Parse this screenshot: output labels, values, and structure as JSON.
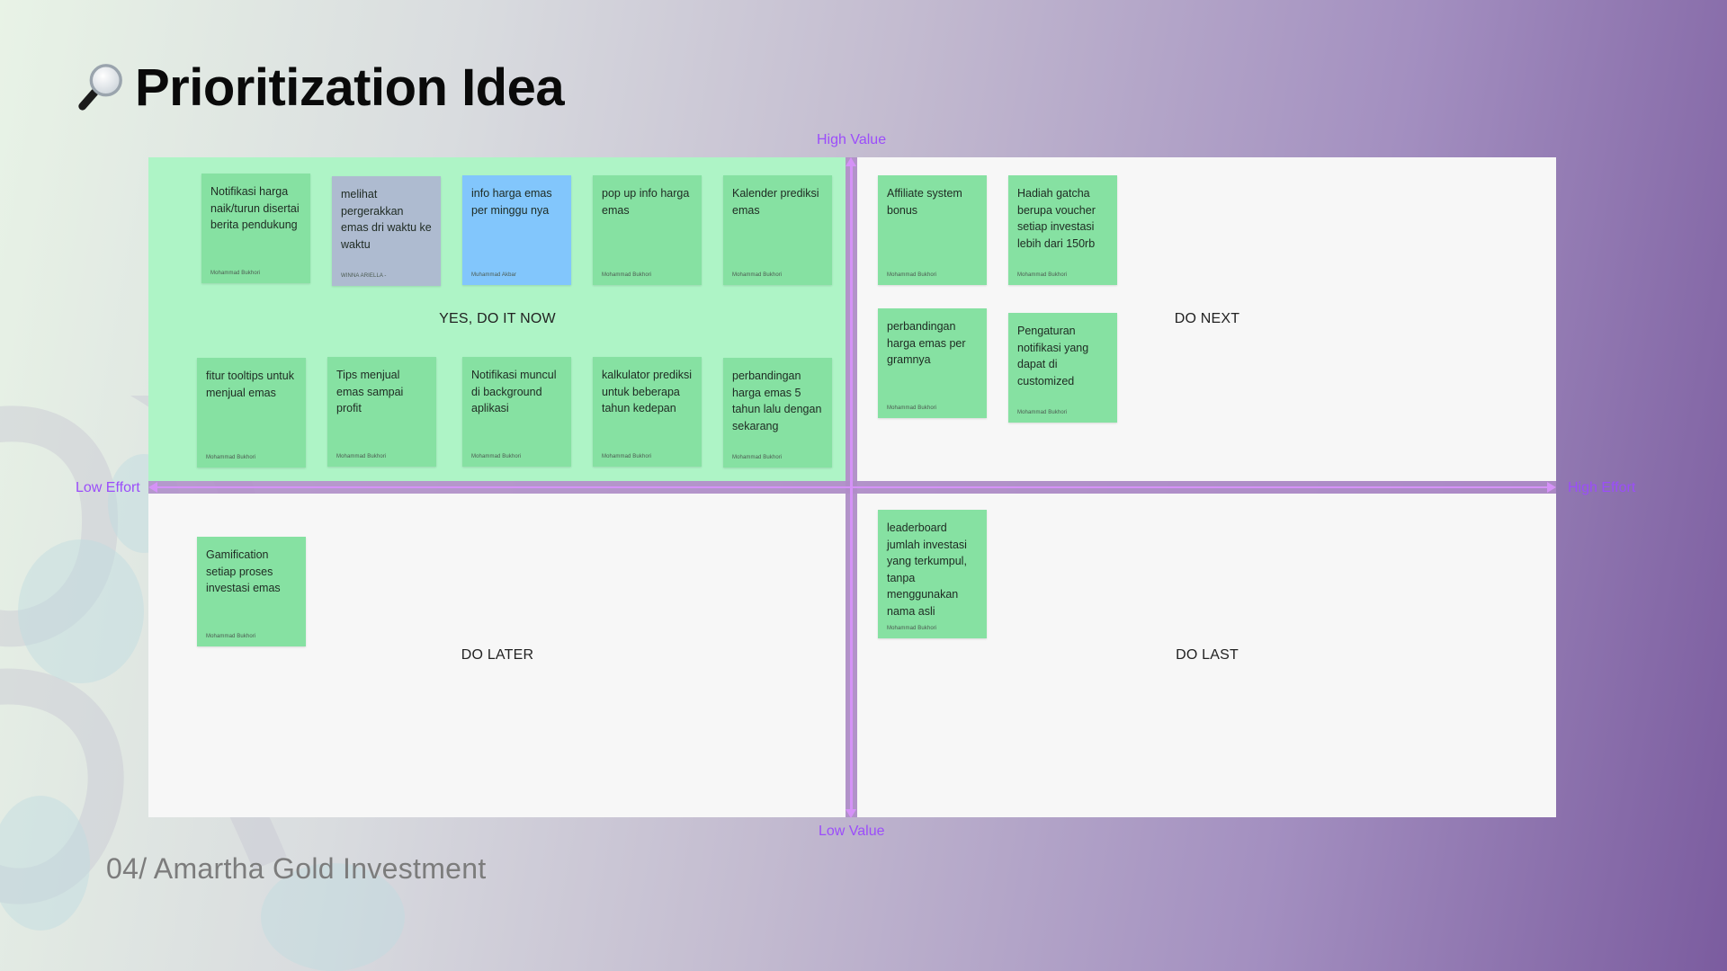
{
  "title": {
    "icon": "magnifying-glass-icon",
    "text": "Prioritization Idea"
  },
  "axes": {
    "top": "High Value",
    "bottom": "Low Value",
    "left": "Low Effort",
    "right": "High Effort",
    "color": "#9b4dfa",
    "line_color": "#d592f7"
  },
  "quadrants": {
    "top_left": {
      "label": "YES, DO IT NOW",
      "color": "#aef4c6"
    },
    "top_right": {
      "label": "DO NEXT",
      "color": "#f7f7f7"
    },
    "bottom_left": {
      "label": "DO LATER",
      "color": "#f7f7f7"
    },
    "bottom_right": {
      "label": "DO LAST",
      "color": "#f7f7f7"
    }
  },
  "sticky_colors": {
    "green": "#86e1a2",
    "gray": "#aebbd0",
    "blue": "#82c6fc"
  },
  "stickies": [
    {
      "quadrant": "top_left",
      "text": "Notifikasi harga naik/turun disertai berita pendukung",
      "author": "Mohammad Bukhori",
      "color": "green"
    },
    {
      "quadrant": "top_left",
      "text": "melihat pergerakkan emas dri waktu ke waktu",
      "author": "WINNA ARIELLA -",
      "color": "gray"
    },
    {
      "quadrant": "top_left",
      "text": "info harga emas per minggu nya",
      "author": "Muhammad Akbar",
      "color": "blue"
    },
    {
      "quadrant": "top_left",
      "text": "pop up info harga emas",
      "author": "Mohammad Bukhori",
      "color": "green"
    },
    {
      "quadrant": "top_left",
      "text": "Kalender prediksi emas",
      "author": "Mohammad Bukhori",
      "color": "green"
    },
    {
      "quadrant": "top_left",
      "text": "fitur tooltips untuk menjual emas",
      "author": "Mohammad Bukhori",
      "color": "green"
    },
    {
      "quadrant": "top_left",
      "text": "Tips menjual emas sampai profit",
      "author": "Mohammad Bukhori",
      "color": "green"
    },
    {
      "quadrant": "top_left",
      "text": "Notifikasi muncul di background aplikasi",
      "author": "Mohammad Bukhori",
      "color": "green"
    },
    {
      "quadrant": "top_left",
      "text": "kalkulator prediksi untuk beberapa tahun kedepan",
      "author": "Mohammad Bukhori",
      "color": "green"
    },
    {
      "quadrant": "top_left",
      "text": "perbandingan harga emas 5 tahun lalu dengan sekarang",
      "author": "Mohammad Bukhori",
      "color": "green"
    },
    {
      "quadrant": "top_right",
      "text": "Affiliate system bonus",
      "author": "Mohammad Bukhori",
      "color": "green"
    },
    {
      "quadrant": "top_right",
      "text": "Hadiah gatcha berupa voucher setiap investasi lebih dari 150rb",
      "author": "Mohammad Bukhori",
      "color": "green"
    },
    {
      "quadrant": "top_right",
      "text": "perbandingan harga emas per gramnya",
      "author": "Mohammad Bukhori",
      "color": "green"
    },
    {
      "quadrant": "top_right",
      "text": "Pengaturan notifikasi yang dapat di customized",
      "author": "Mohammad Bukhori",
      "color": "green"
    },
    {
      "quadrant": "bottom_left",
      "text": "Gamification setiap proses investasi emas",
      "author": "Mohammad Bukhori",
      "color": "green"
    },
    {
      "quadrant": "bottom_right",
      "text": "leaderboard jumlah investasi yang terkumpul, tanpa menggunakan nama asli",
      "author": "Mohammad Bukhori",
      "color": "green"
    }
  ],
  "footer": "04/ Amartha Gold Investment"
}
